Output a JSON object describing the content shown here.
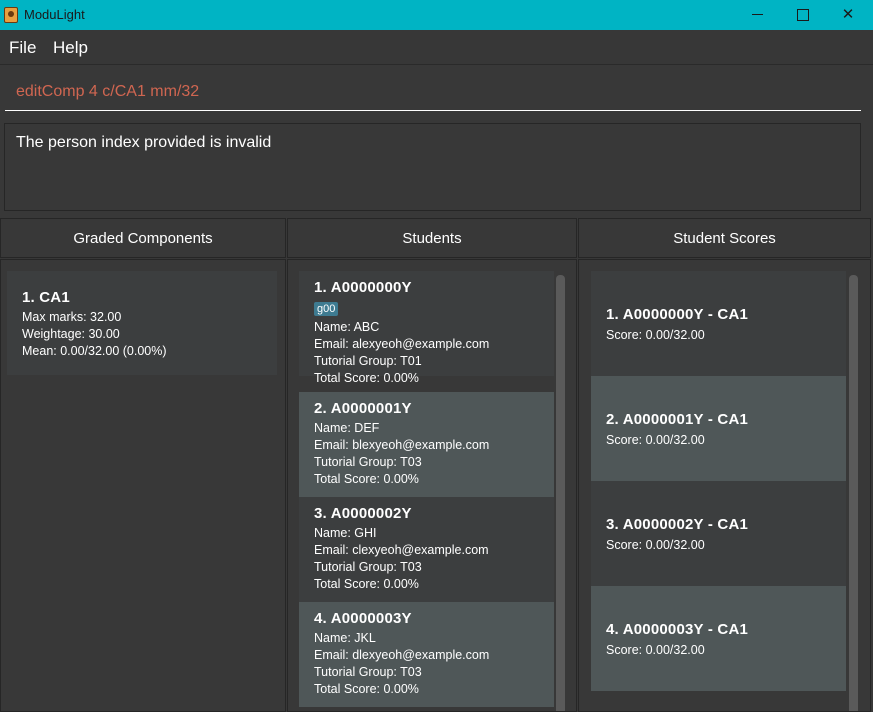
{
  "window": {
    "title": "ModuLight"
  },
  "menu": {
    "file": "File",
    "help": "Help"
  },
  "command": {
    "value": "editComp 4 c/CA1 mm/32"
  },
  "result": {
    "text": "The person index provided is invalid"
  },
  "headers": {
    "components": "Graded Components",
    "students": "Students",
    "scores": "Student Scores"
  },
  "components": [
    {
      "title": "1.  CA1",
      "max_marks": "Max marks: 32.00",
      "weightage": "Weightage: 30.00",
      "mean": "Mean: 0.00/32.00 (0.00%)"
    }
  ],
  "students": [
    {
      "title": "1.  A0000000Y",
      "tag": "g00",
      "name": "Name: ABC",
      "email": "Email: alexyeoh@example.com",
      "group": "Tutorial Group: T01",
      "total": "Total Score: 0.00%"
    },
    {
      "title": "2.  A0000001Y",
      "name": "Name: DEF",
      "email": "Email: blexyeoh@example.com",
      "group": "Tutorial Group: T03",
      "total": "Total Score: 0.00%"
    },
    {
      "title": "3.  A0000002Y",
      "name": "Name: GHI",
      "email": "Email: clexyeoh@example.com",
      "group": "Tutorial Group: T03",
      "total": "Total Score: 0.00%"
    },
    {
      "title": "4.  A0000003Y",
      "name": "Name: JKL",
      "email": "Email: dlexyeoh@example.com",
      "group": "Tutorial Group: T03",
      "total": "Total Score: 0.00%"
    }
  ],
  "scores": [
    {
      "title": "1.  A0000000Y - CA1",
      "score": "Score: 0.00/32.00"
    },
    {
      "title": "2.  A0000001Y - CA1",
      "score": "Score: 0.00/32.00"
    },
    {
      "title": "3.  A0000002Y - CA1",
      "score": "Score: 0.00/32.00"
    },
    {
      "title": "4.  A0000003Y - CA1",
      "score": "Score: 0.00/32.00"
    }
  ],
  "colors": {
    "titlebar": "#00b4c4",
    "background": "#383838",
    "command_text": "#d06651",
    "tag": "#3e7b91"
  },
  "icons": {
    "app": "app-icon",
    "minimize": "minimize-icon",
    "maximize": "maximize-icon",
    "close": "close-icon"
  }
}
